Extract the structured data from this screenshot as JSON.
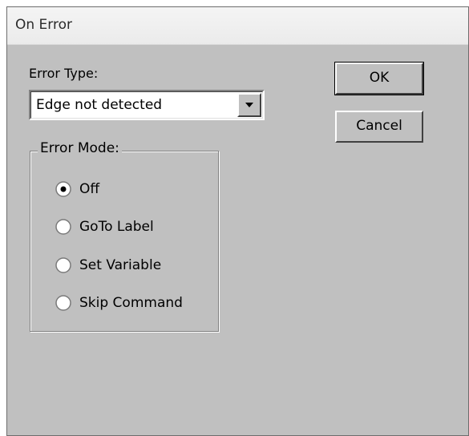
{
  "dialog": {
    "title": "On Error"
  },
  "error_type": {
    "label": "Error Type:",
    "selected": "Edge not detected"
  },
  "buttons": {
    "ok": "OK",
    "cancel": "Cancel"
  },
  "error_mode": {
    "legend": "Error Mode:",
    "options": [
      {
        "label": "Off",
        "selected": true
      },
      {
        "label": "GoTo Label",
        "selected": false
      },
      {
        "label": "Set Variable",
        "selected": false
      },
      {
        "label": "Skip Command",
        "selected": false
      }
    ]
  }
}
